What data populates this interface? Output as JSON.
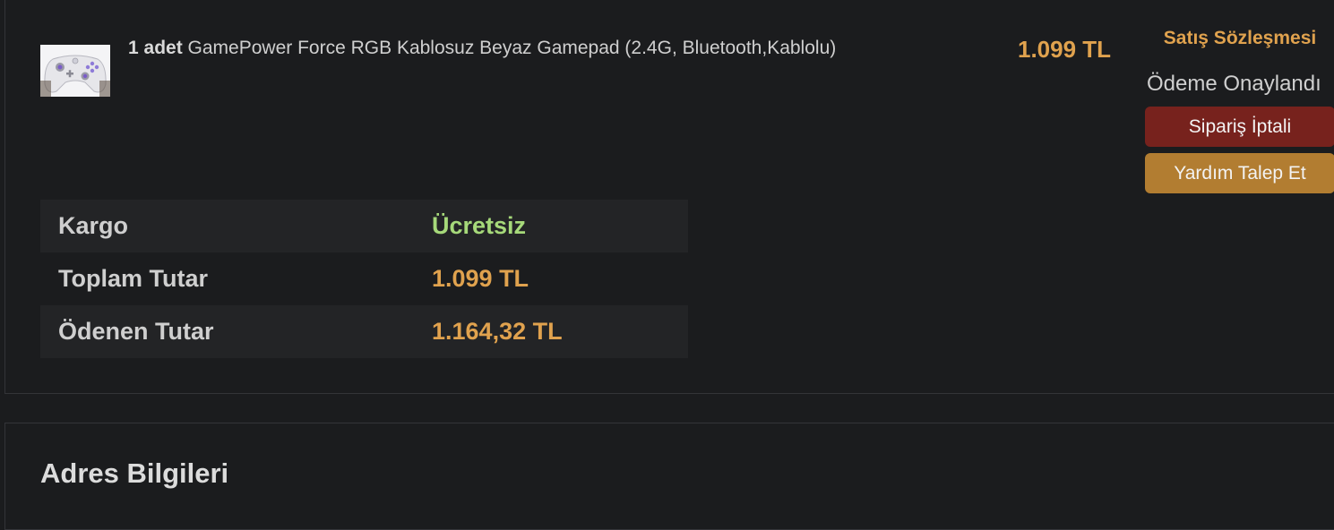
{
  "order": {
    "product": {
      "quantity": "1 adet",
      "name": "GamePower Force RGB Kablosuz Beyaz Gamepad (2.4G, Bluetooth,Kablolu)",
      "price": "1.099 TL",
      "image_icon": "white-gamepad-image"
    },
    "actions": {
      "contract_link": "Satış Sözleşmesi",
      "payment_status": "Ödeme Onaylandı",
      "cancel_button": "Sipariş İptali",
      "help_button": "Yardım Talep Et"
    },
    "summary": [
      {
        "label": "Kargo",
        "value": "Ücretsiz",
        "highlight": "free"
      },
      {
        "label": "Toplam Tutar",
        "value": "1.099 TL",
        "highlight": "amount"
      },
      {
        "label": "Ödenen Tutar",
        "value": "1.164,32 TL",
        "highlight": "amount"
      }
    ]
  },
  "address": {
    "title": "Adres Bilgileri"
  },
  "colors": {
    "background": "#1b1c1e",
    "accent_orange": "#e0a24e",
    "free_green": "#a6d97a",
    "cancel_red": "#77221d",
    "help_gold": "#b27d31"
  }
}
